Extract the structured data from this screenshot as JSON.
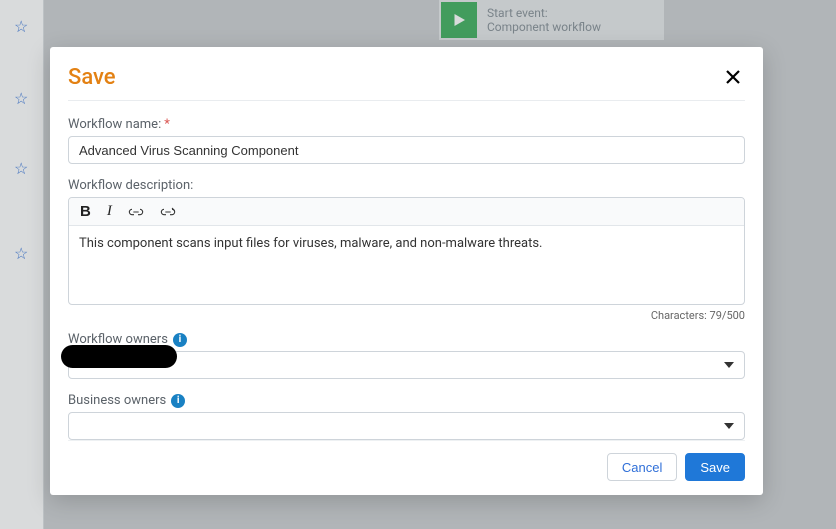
{
  "background": {
    "start_event": {
      "line1": "Start event:",
      "line2": "Component workflow"
    }
  },
  "modal": {
    "title": "Save",
    "fields": {
      "name": {
        "label": "Workflow name:",
        "required": "*",
        "value": "Advanced Virus Scanning Component"
      },
      "description": {
        "label": "Workflow description:",
        "value": "This component scans input files for viruses, malware, and non-malware threats.",
        "char_line": "Characters: 79/500"
      },
      "workflow_owners": {
        "label": "Workflow owners"
      },
      "business_owners": {
        "label": "Business owners"
      }
    },
    "footer": {
      "cancel": "Cancel",
      "save": "Save"
    }
  },
  "toolbar": {
    "bold": "B",
    "italic": "I"
  }
}
